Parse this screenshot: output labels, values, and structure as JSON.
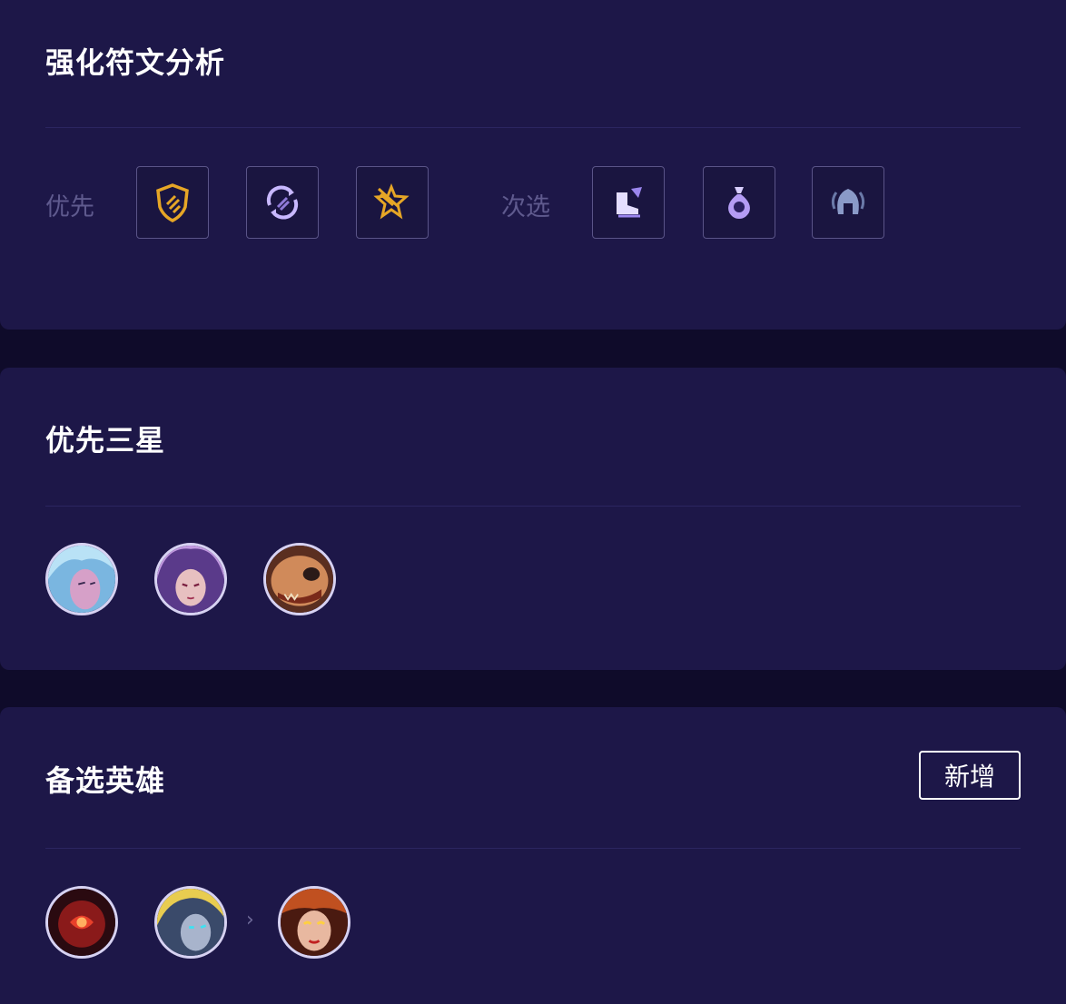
{
  "colors": {
    "page_bg": "#0f0b2a",
    "panel_bg": "#1d1748",
    "title": "#ffffff",
    "label": "#5f5a8e",
    "rune_border": "#5a5488",
    "rune_gold": "#e6a626",
    "rune_purple": "#c8b8ff"
  },
  "augments": {
    "title": "强化符文分析",
    "primary_label": "优先",
    "secondary_label": "次选",
    "primary_icons": [
      "shield-augment-icon",
      "circular-arrows-augment-icon",
      "star-feather-augment-icon"
    ],
    "secondary_icons": [
      "boots-augment-icon",
      "money-bag-augment-icon",
      "helmet-augment-icon"
    ]
  },
  "three_star": {
    "title": "优先三星",
    "champions": [
      "champion-portrait-blue-hair",
      "champion-portrait-pink-hair",
      "champion-portrait-beast"
    ]
  },
  "alternates": {
    "title": "备选英雄",
    "add_label": "新增",
    "arrow": "›",
    "champions": [
      "champion-portrait-red",
      "champion-portrait-blonde",
      "champion-portrait-fire-mask"
    ]
  }
}
